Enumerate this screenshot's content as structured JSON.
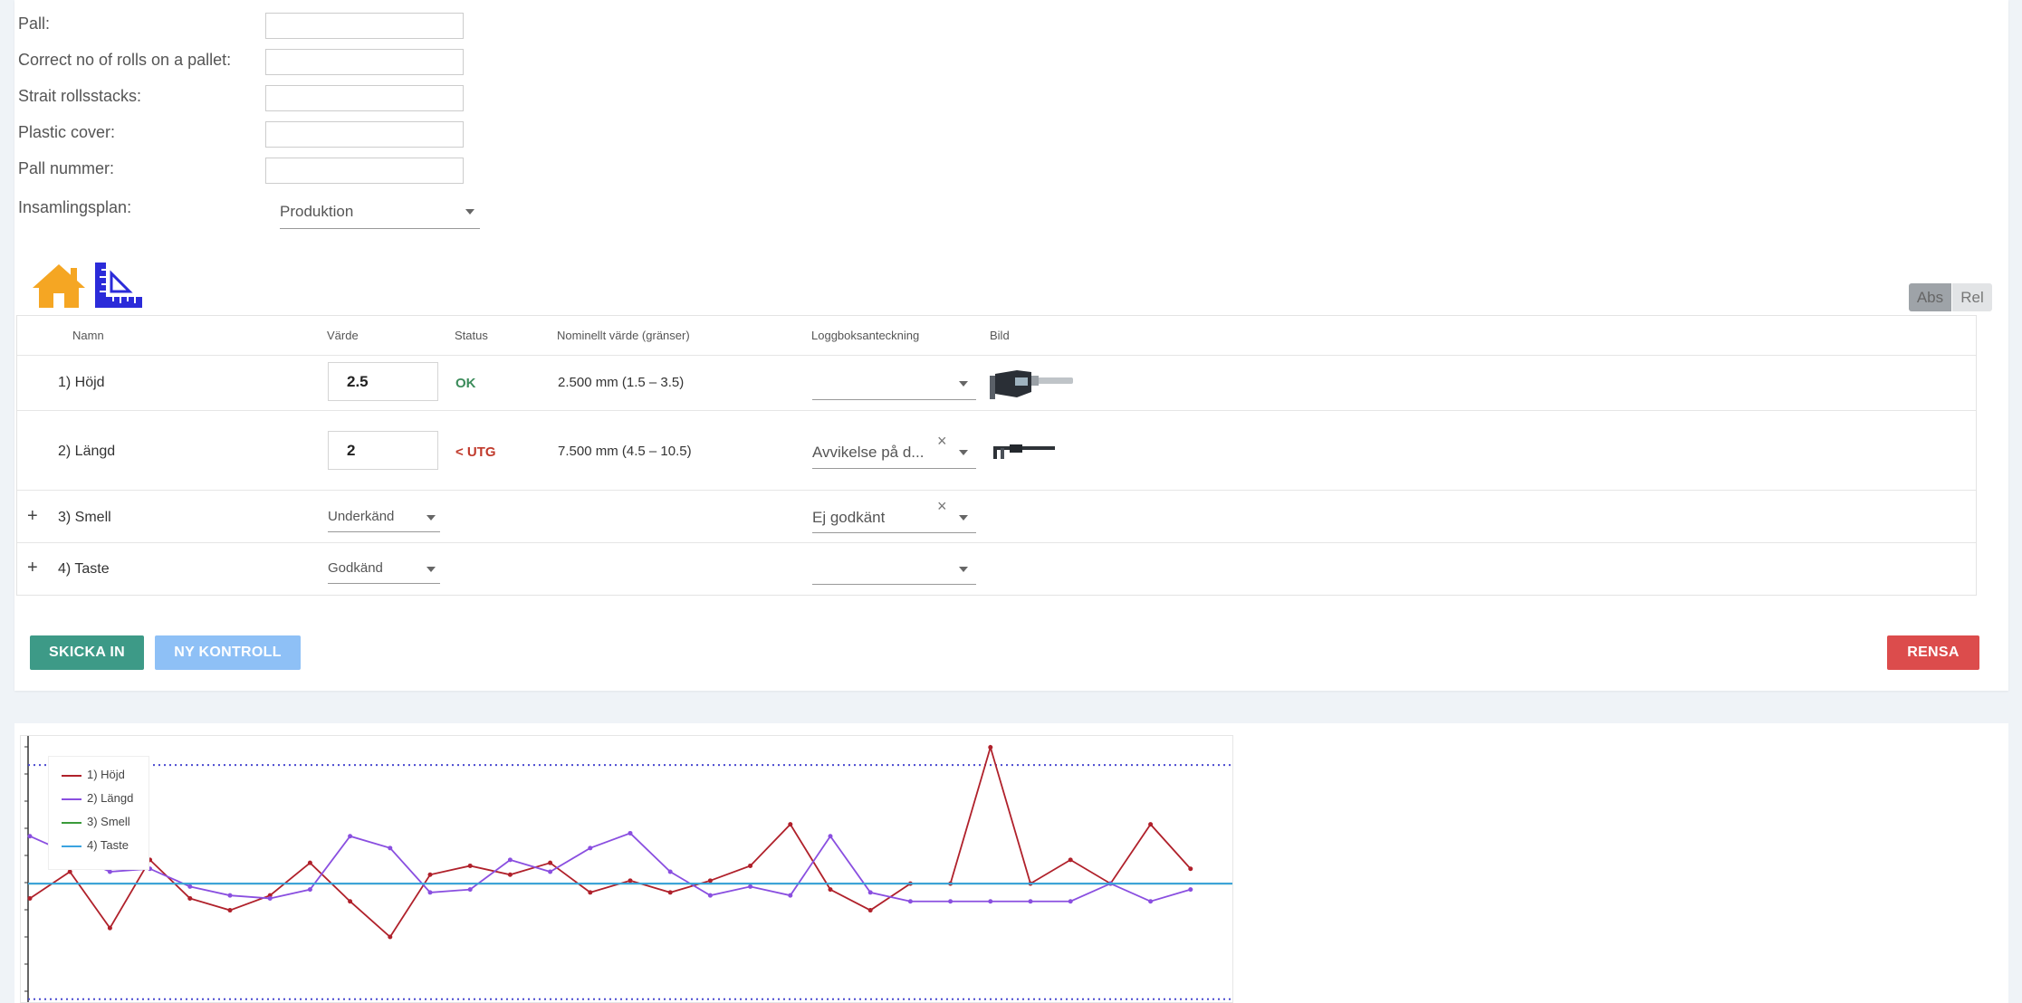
{
  "form": {
    "fields": [
      {
        "label": "Pall:",
        "value": ""
      },
      {
        "label": "Correct no of rolls on a pallet:",
        "value": ""
      },
      {
        "label": "Strait rollsstacks:",
        "value": ""
      },
      {
        "label": "Plastic cover:",
        "value": ""
      },
      {
        "label": "Pall nummer:",
        "value": ""
      }
    ],
    "plan_label": "Insamlingsplan:",
    "plan_value": "Produktion"
  },
  "icons": {
    "home": "home-icon",
    "ruler": "ruler-icon"
  },
  "toggle": {
    "abs": "Abs",
    "rel": "Rel"
  },
  "table": {
    "headers": {
      "name": "Namn",
      "value": "Värde",
      "status": "Status",
      "nominal": "Nominellt värde (gränser)",
      "log": "Loggboksanteckning",
      "image": "Bild"
    },
    "rows": [
      {
        "name": "1) Höjd",
        "value": "2.5",
        "status": "OK",
        "nominal": "2.500 mm (1.5 – 3.5)",
        "log": "",
        "image": "micrometer-image"
      },
      {
        "name": "2) Längd",
        "value": "2",
        "status": "< UTG",
        "nominal": "7.500 mm (4.5 – 10.5)",
        "log": "Avvikelse på d...",
        "image": "caliper-image"
      },
      {
        "name": "3) Smell",
        "value": "Underkänd",
        "status": "",
        "nominal": "",
        "log": "Ej godkänt",
        "expand": "+"
      },
      {
        "name": "4) Taste",
        "value": "Godkänd",
        "status": "",
        "nominal": "",
        "log": "",
        "expand": "+"
      }
    ]
  },
  "buttons": {
    "submit": "SKICKA IN",
    "new": "NY KONTROLL",
    "clear": "RENSA"
  },
  "colors": {
    "submit": "#3d9a87",
    "new": "#8ec0f6",
    "clear": "#dc4c4c",
    "ok": "#3c8c5b",
    "bad": "#c0392b",
    "home": "#f5a623",
    "ruler": "#2b2bd9"
  },
  "chart_data": {
    "type": "line",
    "x": [
      1,
      2,
      3,
      4,
      5,
      6,
      7,
      8,
      9,
      10,
      11,
      12,
      13,
      14,
      15,
      16,
      17,
      18,
      19,
      20,
      21,
      22,
      23,
      24,
      25,
      26,
      27,
      28,
      29,
      30
    ],
    "series": [
      {
        "name": "1) Höjd",
        "color": "#b0212b",
        "values": [
          -0.25,
          0.2,
          -0.75,
          0.4,
          -0.25,
          -0.45,
          -0.2,
          0.35,
          -0.3,
          -0.9,
          0.15,
          0.3,
          0.15,
          0.35,
          -0.15,
          0.05,
          -0.15,
          0.05,
          0.3,
          1.0,
          -0.1,
          -0.45,
          0,
          0,
          2.3,
          0,
          0.4,
          0,
          1.0,
          0.25
        ]
      },
      {
        "name": "2) Längd",
        "color": "#8a4fe0",
        "values": [
          0.8,
          0.5,
          0.2,
          0.25,
          -0.05,
          -0.2,
          -0.25,
          -0.1,
          0.8,
          0.6,
          -0.15,
          -0.1,
          0.4,
          0.2,
          0.6,
          0.85,
          0.2,
          -0.2,
          -0.05,
          -0.2,
          0.8,
          -0.15,
          -0.3,
          -0.3,
          -0.3,
          -0.3,
          -0.3,
          0,
          -0.3,
          -0.1
        ]
      },
      {
        "name": "3) Smell",
        "color": "#3a9b3a",
        "values": [
          0,
          0,
          0,
          0,
          0,
          0,
          0,
          0,
          0,
          0,
          0,
          0,
          0,
          0,
          0,
          0,
          0,
          0,
          0,
          0,
          0,
          0,
          0,
          0,
          0,
          0,
          0,
          0,
          0,
          0
        ]
      },
      {
        "name": "4) Taste",
        "color": "#3aa3e0",
        "values": [
          0,
          0,
          0,
          0,
          0,
          0,
          0,
          0,
          0,
          0,
          0,
          0,
          0,
          0,
          0,
          0,
          0,
          0,
          0,
          0,
          0,
          0,
          0,
          0,
          0,
          0,
          0,
          0,
          0,
          0
        ]
      }
    ],
    "ylim": [
      -2.0,
      2.4
    ],
    "limits": [
      2.0,
      -1.95
    ],
    "grid": false,
    "legend": "top-left"
  }
}
